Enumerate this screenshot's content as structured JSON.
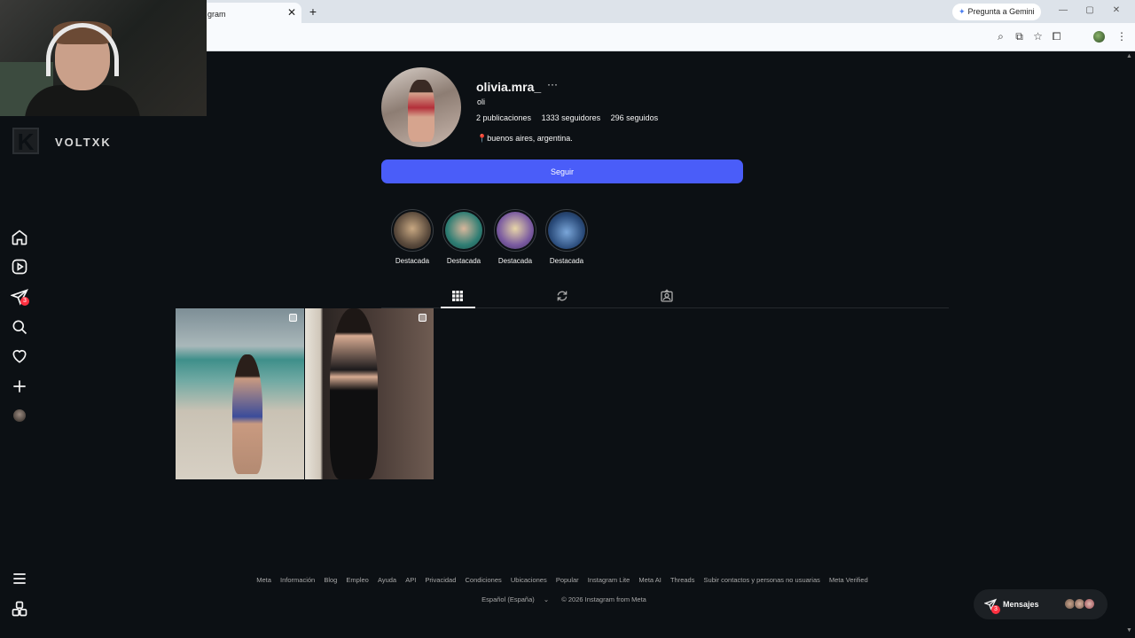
{
  "browser": {
    "tab_title": "gram",
    "tab_close": "✕",
    "new_tab": "+",
    "gemini_label": "Pregunta a Gemini",
    "window_controls": [
      "—",
      "▢",
      "✕"
    ]
  },
  "brand": {
    "logo_letter": "K",
    "name": "VOLTXK"
  },
  "sidebar": {
    "items": [
      {
        "name": "home",
        "icon": "home-icon"
      },
      {
        "name": "reels",
        "icon": "reels-icon"
      },
      {
        "name": "messages",
        "icon": "send-icon",
        "badge": "3"
      },
      {
        "name": "search",
        "icon": "search-icon"
      },
      {
        "name": "notifications",
        "icon": "heart-icon"
      },
      {
        "name": "create",
        "icon": "plus-icon"
      },
      {
        "name": "profile",
        "icon": "avatar"
      }
    ],
    "bottom": [
      {
        "name": "more",
        "icon": "menu-icon"
      },
      {
        "name": "also-from-meta",
        "icon": "apps-icon"
      }
    ]
  },
  "profile": {
    "username": "olivia.mra_",
    "more": "···",
    "full_name": "oli",
    "stats": {
      "posts": "2 publicaciones",
      "followers": "1333 seguidores",
      "following": "296 seguidos"
    },
    "location_pin": "📍",
    "location": "buenos aires, argentina.",
    "follow_label": "Seguir"
  },
  "highlights": [
    {
      "label": "Destacada",
      "color": "#5a4a3c"
    },
    {
      "label": "Destacada",
      "color": "#2e7d73"
    },
    {
      "label": "Destacada",
      "color": "#7a5aa0"
    },
    {
      "label": "Destacada",
      "color": "#2a4b7a"
    }
  ],
  "profile_tabs": [
    {
      "name": "posts",
      "icon": "grid-icon",
      "active": true
    },
    {
      "name": "reposts",
      "icon": "repost-icon",
      "active": false
    },
    {
      "name": "tagged",
      "icon": "tagged-icon",
      "active": false
    }
  ],
  "footer": {
    "links": [
      "Meta",
      "Información",
      "Blog",
      "Empleo",
      "Ayuda",
      "API",
      "Privacidad",
      "Condiciones",
      "Ubicaciones",
      "Popular",
      "Instagram Lite",
      "Meta AI",
      "Threads",
      "Subir contactos y personas no usuarias",
      "Meta Verified"
    ],
    "language": "Español (España)",
    "copyright": "© 2026 Instagram from Meta"
  },
  "messages_pill": {
    "label": "Mensajes",
    "badge": "3"
  },
  "colors": {
    "background": "#0c1014",
    "accent": "#4a5df9",
    "badge": "#ff3040"
  }
}
